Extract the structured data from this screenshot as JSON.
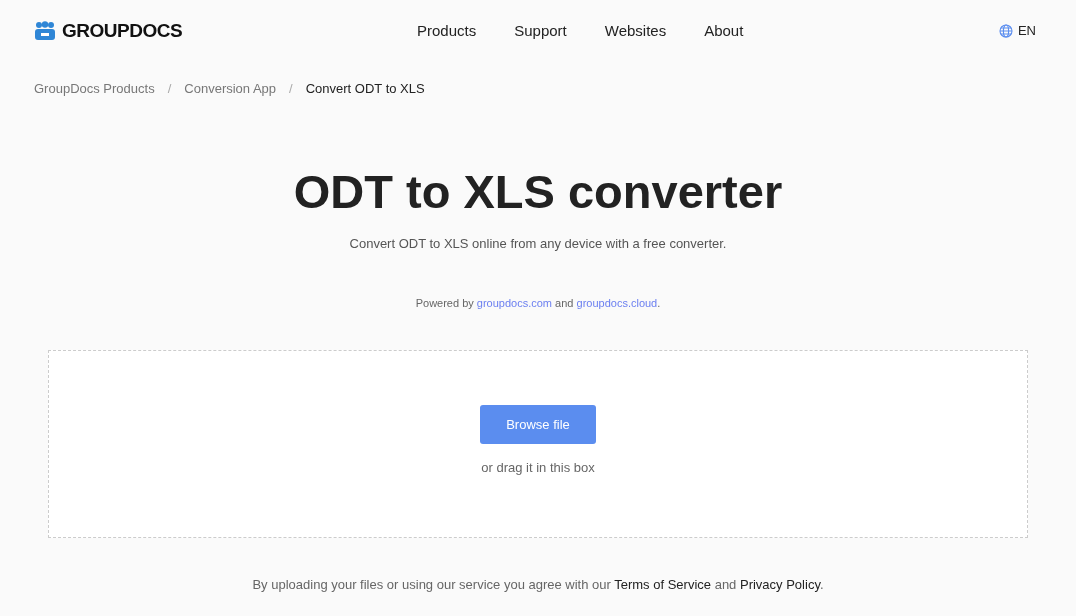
{
  "header": {
    "logo": "GROUPDOCS",
    "nav": [
      "Products",
      "Support",
      "Websites",
      "About"
    ],
    "language": "EN"
  },
  "breadcrumbs": [
    {
      "label": "GroupDocs Products",
      "current": false
    },
    {
      "label": "Conversion App",
      "current": false
    },
    {
      "label": "Convert ODT to XLS",
      "current": true
    }
  ],
  "breadcrumb_separator": "/",
  "title": "ODT to XLS converter",
  "subtitle": "Convert ODT to XLS online from any device with a free converter.",
  "powered_by": [
    {
      "kind": "text",
      "text": "Powered by "
    },
    {
      "kind": "link",
      "text": "groupdocs.com"
    },
    {
      "kind": "text",
      "text": " and "
    },
    {
      "kind": "link",
      "text": "groupdocs.cloud"
    },
    {
      "kind": "text",
      "text": "."
    }
  ],
  "upload": {
    "button": "Browse file",
    "hint": "or drag it in this box"
  },
  "terms": [
    {
      "kind": "text",
      "text": "By uploading your files or using our service you agree with our "
    },
    {
      "kind": "link",
      "text": "Terms of Service"
    },
    {
      "kind": "text",
      "text": " and "
    },
    {
      "kind": "link",
      "text": "Privacy Policy"
    },
    {
      "kind": "text",
      "text": "."
    }
  ]
}
